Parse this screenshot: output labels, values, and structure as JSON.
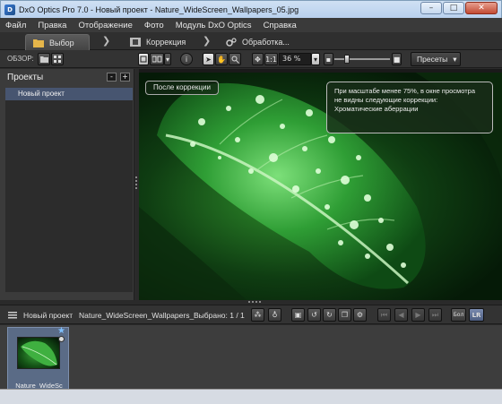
{
  "window": {
    "title": "DxO Optics Pro 7.0 - Новый проект - Nature_WideScreen_Wallpapers_05.jpg",
    "app_icon": "dxo-logo-icon",
    "minimize": "–",
    "maximize": "□",
    "close": "✕"
  },
  "menu": [
    "Файл",
    "Правка",
    "Отображение",
    "Фото",
    "Модуль DxO Optics",
    "Справка"
  ],
  "workflow": {
    "tabs": [
      {
        "label": "Выбор",
        "icon": "folder-icon",
        "active": true
      },
      {
        "label": "Коррекция",
        "icon": "film-icon",
        "active": false
      },
      {
        "label": "Обработка...",
        "icon": "gears-icon",
        "active": false
      }
    ],
    "chevron": "❯"
  },
  "toolbar": {
    "browse_label": "ОБЗОР:",
    "zoom_value": "36 %",
    "zoom_fit": "1:1",
    "presets_label": "Пресеты",
    "zoom_slider_fraction": 0.2
  },
  "projects": {
    "header": "Проекты",
    "minus": "-",
    "plus": "+",
    "items": [
      "Новый проект"
    ]
  },
  "viewer": {
    "after_badge": "После коррекции",
    "notice": [
      "При масштабе менее 75%, в окне просмотра",
      "не видны следующие коррекции:",
      "Хроматические аберрации"
    ]
  },
  "filmbar": {
    "project": "Новый проект",
    "file": "Nature_WideScreen_Wallpapers_",
    "selected": "Выбрано: 1 / 1",
    "mode_label": "Бол",
    "lr_label": "LR"
  },
  "filmstrip": {
    "items": [
      {
        "label": "Nature_WideSc",
        "starred": true
      }
    ]
  },
  "colors": {
    "accent_selected": "#475570",
    "panel": "#3b3b3b",
    "toolbar": "#333333"
  }
}
